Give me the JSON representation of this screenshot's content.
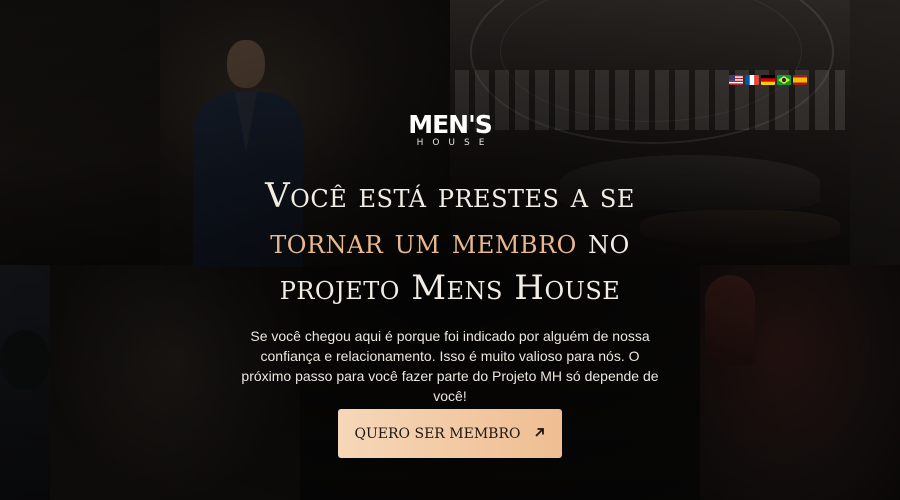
{
  "brand": {
    "logo_main": "MEN'S",
    "logo_sub": "HOUSE"
  },
  "languages": [
    {
      "code": "en-us",
      "icon": "usa-flag-icon"
    },
    {
      "code": "fr",
      "icon": "france-flag-icon"
    },
    {
      "code": "de",
      "icon": "germany-flag-icon"
    },
    {
      "code": "pt-br",
      "icon": "brazil-flag-icon"
    },
    {
      "code": "es",
      "icon": "spain-flag-icon"
    }
  ],
  "headline": {
    "line1": "Você está prestes a se",
    "line2_highlight": "tornar um membro",
    "line2_rest": " no",
    "line3": "projeto Mens House"
  },
  "description": "Se você chegou aqui é porque foi indicado por alguém de nossa confiança e relacionamento. Isso é muito valioso para nós. O próximo passo para você fazer parte do Projeto MH só depende de você!",
  "cta": {
    "label": "QUERO SER MEMBRO",
    "icon": "arrow-up-right-icon"
  },
  "colors": {
    "accent": "#e8b98f",
    "button_start": "#f6d7b9",
    "button_end": "#efbe92",
    "text": "#f1ece4"
  }
}
